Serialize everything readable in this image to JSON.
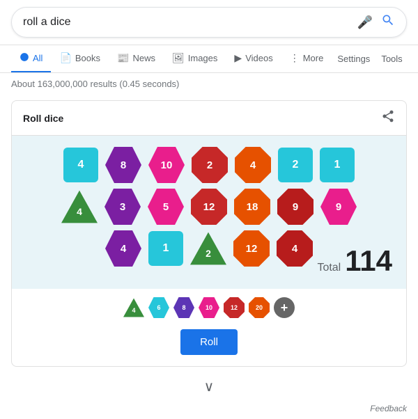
{
  "searchbar": {
    "query": "roll a dice",
    "placeholder": "roll a dice"
  },
  "nav": {
    "tabs": [
      {
        "id": "all",
        "label": "All",
        "icon": "🔍",
        "active": true
      },
      {
        "id": "books",
        "label": "Books",
        "icon": "📄"
      },
      {
        "id": "news",
        "label": "News",
        "icon": "📰"
      },
      {
        "id": "images",
        "label": "Images",
        "icon": "🖼"
      },
      {
        "id": "videos",
        "label": "Videos",
        "icon": "▶"
      },
      {
        "id": "more",
        "label": "More",
        "icon": "⋮"
      }
    ],
    "settings": "Settings",
    "tools": "Tools"
  },
  "results": {
    "count_text": "About 163,000,000 results (0.45 seconds)"
  },
  "widget": {
    "title": "Roll dice",
    "share_icon": "share",
    "total_label": "Total",
    "total_value": "114",
    "dice_rows": [
      [
        {
          "type": "square",
          "color": "#26c6da",
          "value": "4"
        },
        {
          "type": "hex",
          "color": "#7b1fa2",
          "value": "8"
        },
        {
          "type": "hex",
          "color": "#e91e8c",
          "value": "10"
        },
        {
          "type": "oct",
          "color": "#c62828",
          "value": "2"
        },
        {
          "type": "oct",
          "color": "#e65100",
          "value": "4"
        },
        {
          "type": "square",
          "color": "#26c6da",
          "value": "2"
        },
        {
          "type": "square",
          "color": "#26c6da",
          "value": "1"
        }
      ],
      [
        {
          "type": "tri",
          "color": "#388e3c",
          "value": "4"
        },
        {
          "type": "hex",
          "color": "#7b1fa2",
          "value": "3"
        },
        {
          "type": "hex",
          "color": "#e91e8c",
          "value": "5"
        },
        {
          "type": "oct",
          "color": "#c62828",
          "value": "12"
        },
        {
          "type": "oct",
          "color": "#e65100",
          "value": "18"
        },
        {
          "type": "oct",
          "color": "#b71c1c",
          "value": "9"
        },
        {
          "type": "hex",
          "color": "#e91e8c",
          "value": "9"
        }
      ],
      [
        {
          "type": "hex",
          "color": "#7b1fa2",
          "value": "4"
        },
        {
          "type": "square",
          "color": "#26c6da",
          "value": "1"
        },
        {
          "type": "tri",
          "color": "#388e3c",
          "value": "2"
        },
        {
          "type": "oct",
          "color": "#e65100",
          "value": "12"
        },
        {
          "type": "oct",
          "color": "#b71c1c",
          "value": "4"
        }
      ]
    ],
    "die_selector": [
      {
        "type": "tri",
        "color": "#388e3c",
        "label": "4"
      },
      {
        "type": "hex",
        "color": "#26c6da",
        "label": "6"
      },
      {
        "type": "hex",
        "color": "#5c35b5",
        "label": "8"
      },
      {
        "type": "hex",
        "color": "#e91e8c",
        "label": "10"
      },
      {
        "type": "oct",
        "color": "#c62828",
        "label": "12"
      },
      {
        "type": "oct",
        "color": "#e65100",
        "label": "20"
      },
      {
        "type": "add",
        "color": "#666",
        "label": "+"
      }
    ],
    "roll_button": "Roll"
  },
  "feedback": {
    "label": "Feedback"
  }
}
